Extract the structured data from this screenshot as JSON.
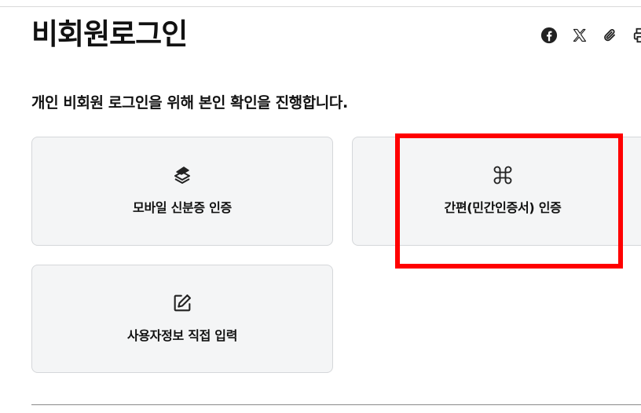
{
  "page": {
    "title": "비회원로그인",
    "subtitle": "개인 비회원 로그인을 위해 본인 확인을 진행합니다."
  },
  "share_bar": {
    "items": [
      {
        "icon": "facebook-icon"
      },
      {
        "icon": "x-icon"
      },
      {
        "icon": "paperclip-icon"
      },
      {
        "icon": "print-icon"
      }
    ]
  },
  "auth_options": [
    {
      "icon": "mobile-id-card-icon",
      "label": "모바일 신분증 인증"
    },
    {
      "icon": "command-key-icon",
      "label": "간편(민간인증서) 인증"
    },
    {
      "icon": "edit-icon",
      "label": "사용자정보 직접 입력"
    }
  ],
  "highlight": {
    "color": "#ff0000",
    "target": "간편(민간인증서) 인증"
  },
  "colors": {
    "card_background": "#f4f5f6",
    "card_border": "#d5d7da",
    "text": "#111111"
  }
}
